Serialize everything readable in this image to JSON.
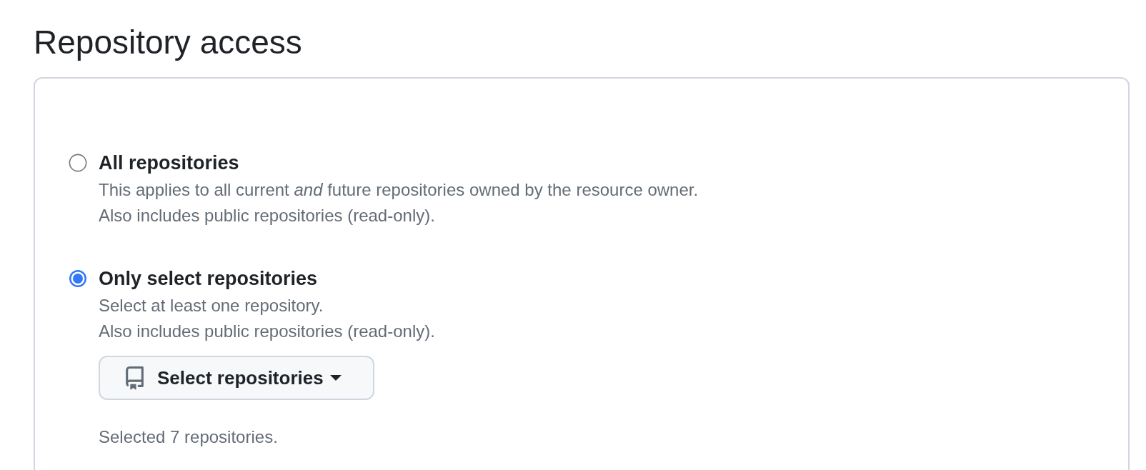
{
  "heading": "Repository access",
  "options": [
    {
      "label": "All repositories",
      "selected": false,
      "description": [
        "This applies to all current *and* future repositories owned by the resource owner.",
        "Also includes public repositories (read-only)."
      ]
    },
    {
      "label": "Only select repositories",
      "selected": true,
      "description": [
        "Select at least one repository.",
        "Also includes public repositories (read-only)."
      ],
      "picker": {
        "label": "Select repositories"
      },
      "summary": "Selected 7 repositories."
    }
  ]
}
